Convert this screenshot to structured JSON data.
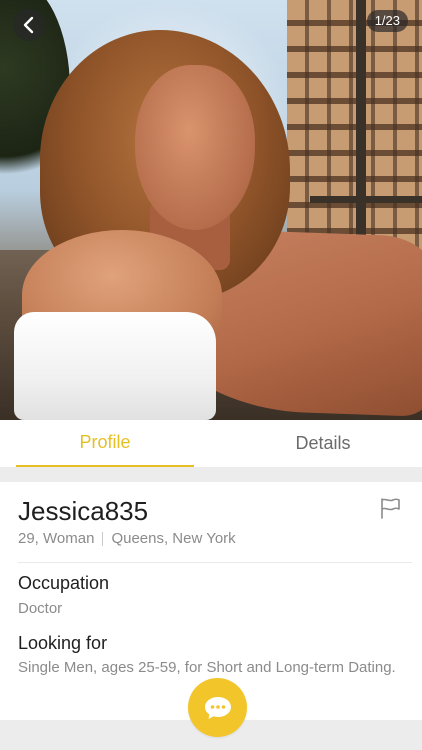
{
  "photo": {
    "counter": "1/23",
    "back_icon": "chevron-left-icon"
  },
  "tabs": [
    {
      "label": "Profile",
      "active": true
    },
    {
      "label": "Details",
      "active": false
    }
  ],
  "profile": {
    "username": "Jessica835",
    "age_gender": "29, Woman",
    "location": "Queens, New York",
    "report_icon": "flag-icon",
    "sections": [
      {
        "label": "Occupation",
        "value": "Doctor"
      },
      {
        "label": "Looking for",
        "value": "Single Men, ages 25-59, for Short and Long-term Dating."
      }
    ]
  },
  "chat_button": {
    "icon": "chat-bubble-icon"
  },
  "colors": {
    "accent": "#f2c62a",
    "tab_active": "#e6bf25",
    "text_primary": "#1f1f1f",
    "text_secondary": "#8b8b8b"
  }
}
